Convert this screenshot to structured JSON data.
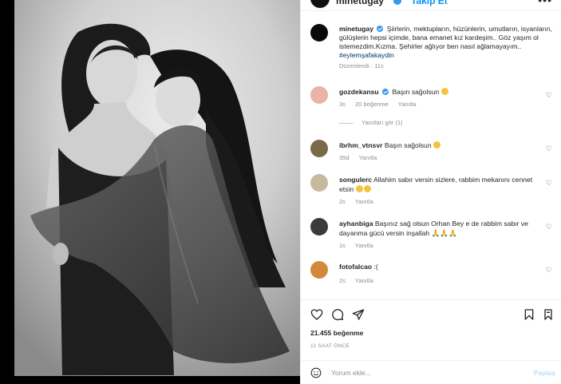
{
  "header": {
    "username": "minetugay",
    "follow_label": "Takip Et",
    "more_icon": "more-icon"
  },
  "caption": {
    "username": "minetugay",
    "text": "Şiirlerin, mektupların, hüzünlerin, umutların, isyanların, gülüşlerin hepsi içimde, bana emanet kız kardeşim.. Göz yaşım ol istemezdim.Kızma. Şehirler ağlıyor ben nasıl ağlamayayım..",
    "hashtag": "#eylemşafakaydin",
    "meta": "Düzenlendi · 11s"
  },
  "comments": [
    {
      "username": "gozdekansu",
      "verified": true,
      "text": "Başın sağolsun",
      "emoji": "sad-face-emoji",
      "time": "3s",
      "likes": "20 beğenme",
      "reply": "Yanıtla"
    },
    {
      "username": "ibrhm_vtnsvr",
      "verified": false,
      "text": "Başın sağolsun",
      "emoji": "sad-face-emoji",
      "time": "35d",
      "reply": "Yanıtla"
    },
    {
      "username": "songulerc",
      "verified": false,
      "text": "Allahim sabır versin sizlere, rabbim mekanını cennet etsin",
      "emoji": "crying-face-emoji",
      "time": "2s",
      "reply": "Yanıtla"
    },
    {
      "username": "ayhanbiga",
      "verified": false,
      "text": "Başınız sağ olsun Orhan Bey e de rabbim sabır ve dayanma gücü versin inşallah",
      "emoji": "praying-hands-emoji",
      "time": "1s",
      "reply": "Yanıtla"
    },
    {
      "username": "fotofalcao",
      "verified": false,
      "text": ":(",
      "time": "2s",
      "reply": "Yanıtla"
    }
  ],
  "replies_label": "Yanıtları gör (1)",
  "likes": "21.455 beğenme",
  "post_time": "11 SAAT ÖNCE",
  "comment_placeholder": "Yorum ekle...",
  "post_button": "Paylaş",
  "colors": {
    "accent": "#0095f6",
    "verified": "#3897f0",
    "muted": "#8e8e8e",
    "post_disabled": "#b2dffc"
  }
}
